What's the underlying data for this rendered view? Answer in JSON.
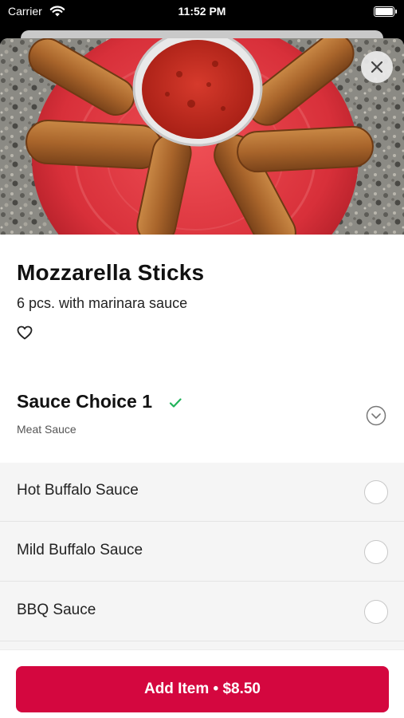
{
  "status_bar": {
    "carrier": "Carrier",
    "time": "11:52 PM"
  },
  "item": {
    "title": "Mozzarella Sticks",
    "description": "6 pcs. with marinara sauce"
  },
  "section": {
    "title": "Sauce Choice 1",
    "selected_value": "Meat Sauce"
  },
  "options": [
    {
      "label": "Hot Buffalo Sauce",
      "selected": false
    },
    {
      "label": "Mild Buffalo Sauce",
      "selected": false
    },
    {
      "label": "BBQ Sauce",
      "selected": false
    }
  ],
  "footer": {
    "add_button_label": "Add Item • $8.50"
  },
  "colors": {
    "accent": "#d4073f",
    "check": "#21b35a"
  },
  "icons": [
    "wifi-icon",
    "battery-icon",
    "close-icon",
    "heart-icon",
    "checkmark-icon",
    "chevron-down-icon"
  ]
}
